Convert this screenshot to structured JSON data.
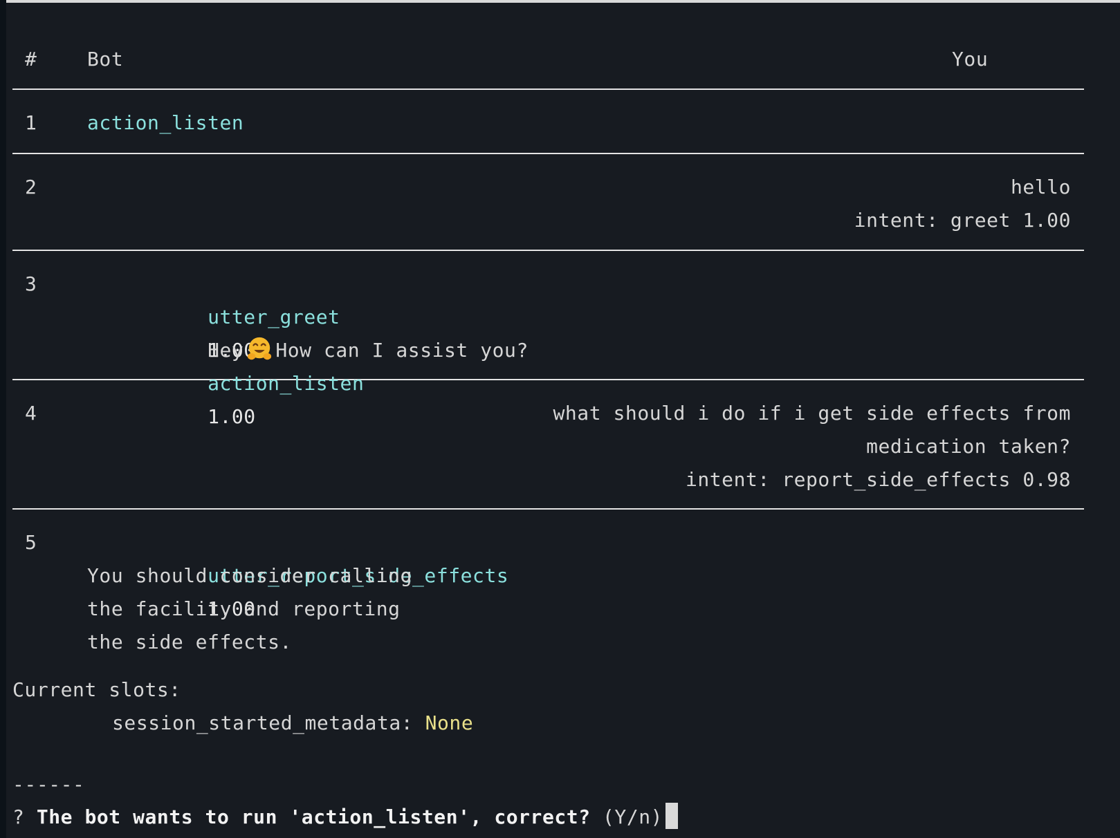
{
  "table": {
    "header": {
      "num": "#",
      "bot": "Bot",
      "you": "You"
    },
    "rows": [
      {
        "num": "1",
        "bot_lines": [
          {
            "action": "action_listen",
            "conf": ""
          }
        ]
      },
      {
        "num": "2",
        "you_lines": [
          "hello",
          "intent: greet 1.00"
        ]
      },
      {
        "num": "3",
        "bot": {
          "action1": "utter_greet",
          "conf1": "1.00",
          "msg_pre": "Hey",
          "msg_post": "How can I assist you?",
          "action2": "action_listen",
          "conf2": "1.00"
        }
      },
      {
        "num": "4",
        "you_lines": [
          "what should i do if i get side effects from",
          "medication taken?",
          "intent: report_side_effects 0.98"
        ]
      },
      {
        "num": "5",
        "bot": {
          "action1": "utter_report_side_effects",
          "conf1": "1.00",
          "lines": [
            "You should consider calling",
            "the facility and reporting",
            "the side effects."
          ]
        }
      }
    ]
  },
  "slots": {
    "label": "Current slots:",
    "key": "session_started_metadata:",
    "value": "None"
  },
  "separator": "------",
  "prompt": {
    "mark": "?",
    "question": "The bot wants to run 'action_listen', correct?",
    "hint": "(Y/n)"
  },
  "colors": {
    "action": "#8be0dd",
    "none_value": "#e9e08a",
    "background": "#171b21"
  },
  "icons": {
    "emoji": "hugging-face-emoji"
  }
}
